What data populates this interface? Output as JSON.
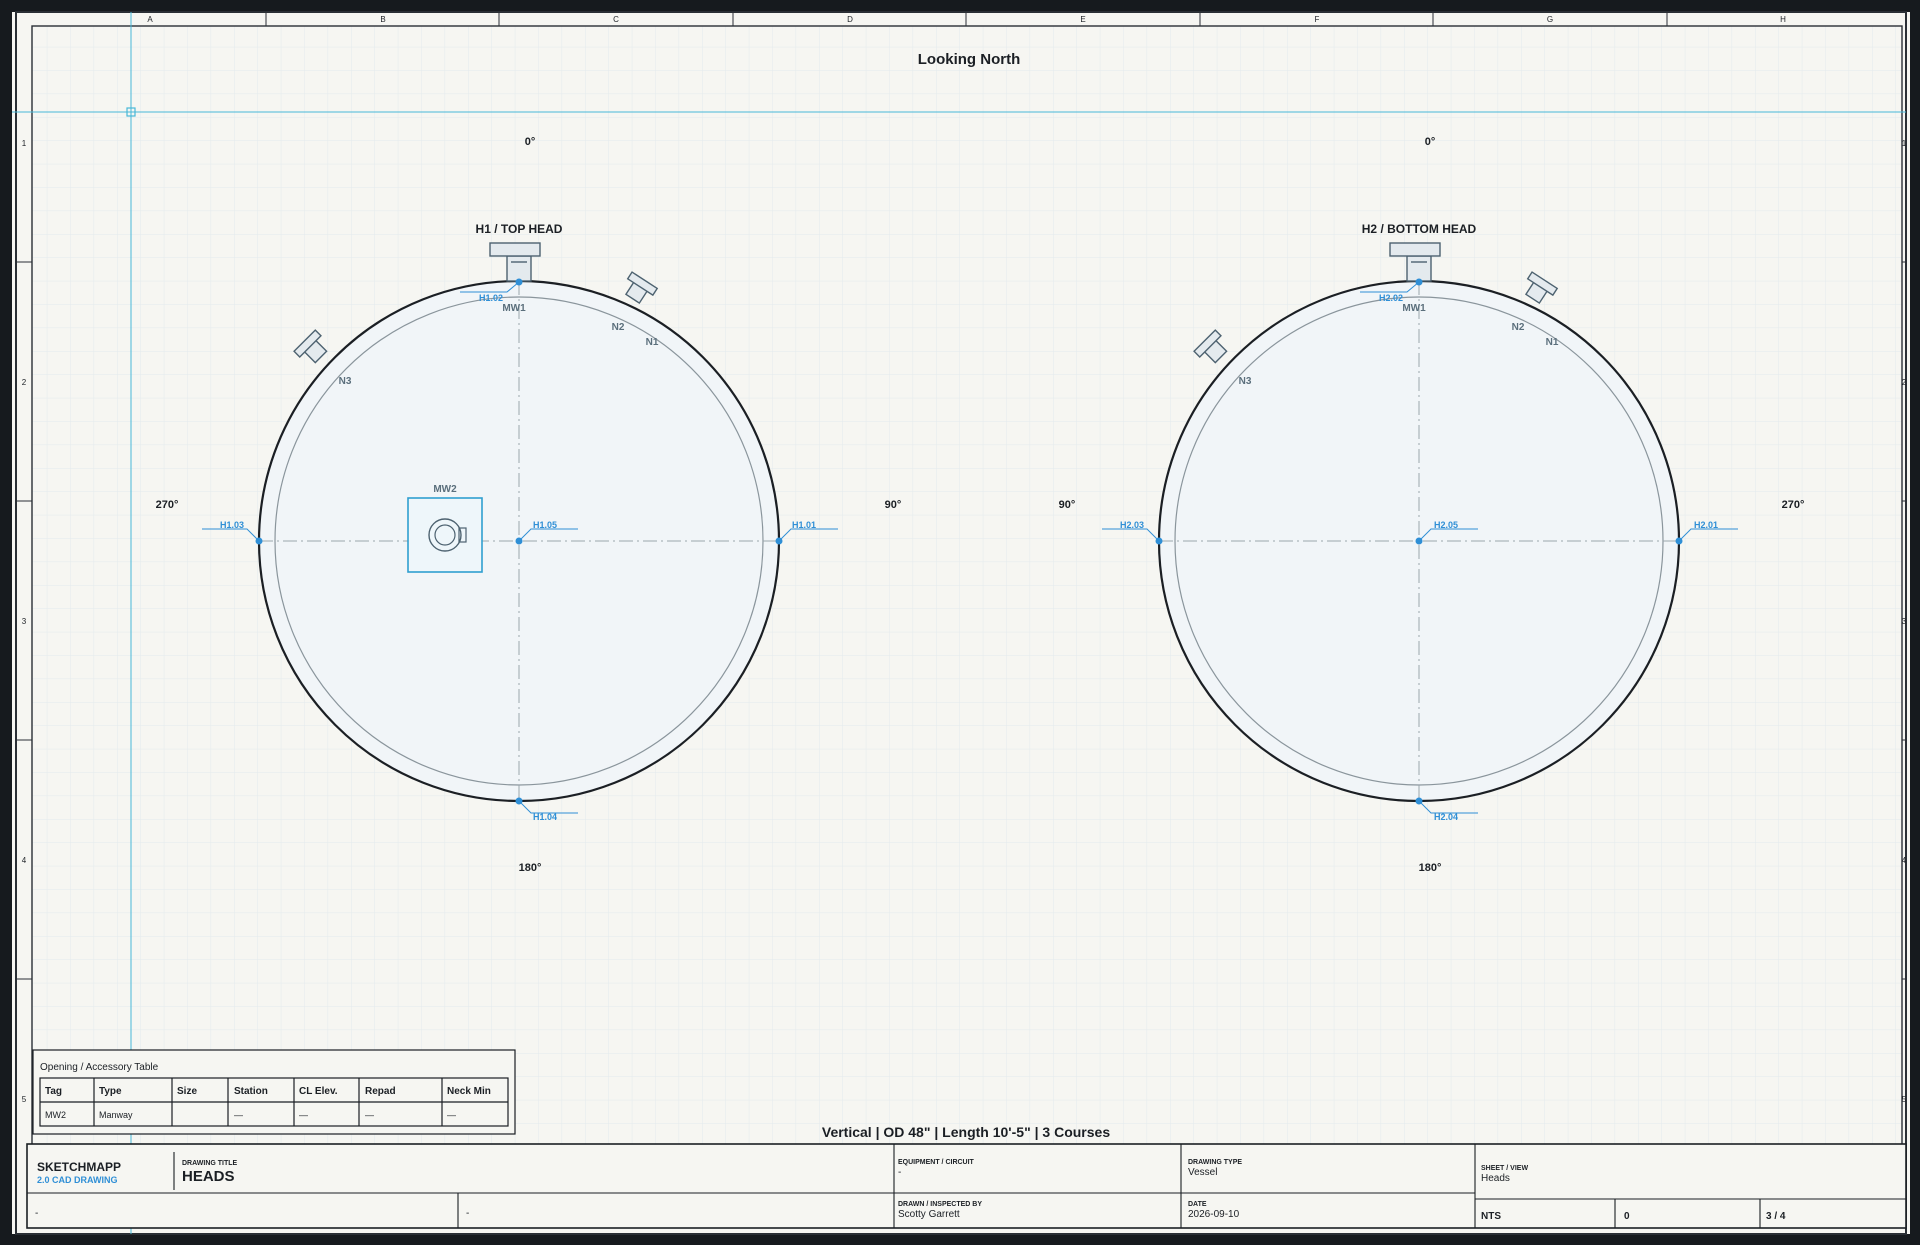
{
  "app": {
    "brand": "SKETCHMAPP",
    "subbrand": "2.0 CAD DRAWING"
  },
  "colors": {
    "accent": "#2f8fd6",
    "paper": "#f6f6f2",
    "ink": "#1b1f24",
    "grid": "#dde5e8",
    "head_fill": "#f1f5f8"
  },
  "frame": {
    "columns": [
      "A",
      "B",
      "C",
      "D",
      "E",
      "F",
      "G",
      "H"
    ],
    "rows": [
      "1",
      "2",
      "3",
      "4",
      "5"
    ]
  },
  "view": {
    "title": "Looking North",
    "footer": "Vertical | OD 48\" | Length 10'-5\" | 3 Courses"
  },
  "heads": [
    {
      "title": "H1 / TOP HEAD",
      "deg_top": "0°",
      "deg_bottom": "180°",
      "deg_left": "270°",
      "deg_right": "90°",
      "points": {
        "top": "H1.02",
        "left": "H1.03",
        "right": "H1.01",
        "bottom": "H1.04",
        "center": "H1.05"
      },
      "nozzles": {
        "top": "MW1",
        "upper_right": "N2",
        "right": "N1",
        "upper_left": "N3"
      },
      "manway_label": "MW2"
    },
    {
      "title": "H2 / BOTTOM HEAD",
      "deg_top": "0°",
      "deg_bottom": "180°",
      "deg_left": "90°",
      "deg_right": "270°",
      "points": {
        "top": "H2.02",
        "left": "H2.03",
        "right": "H2.01",
        "bottom": "H2.04",
        "center": "H2.05"
      },
      "nozzles": {
        "top": "MW1",
        "upper_right": "N2",
        "right": "N1",
        "upper_left": "N3"
      }
    }
  ],
  "table": {
    "title": "Opening / Accessory Table",
    "headers": [
      "Tag",
      "Type",
      "Size",
      "Station",
      "CL Elev.",
      "Repad",
      "Neck Min"
    ],
    "rows": [
      [
        "MW2",
        "Manway",
        "",
        "—",
        "—",
        "—",
        "—"
      ]
    ]
  },
  "title_block": {
    "drawing_title_label": "DRAWING TITLE",
    "drawing_title": "HEADS",
    "equipment_label": "EQUIPMENT / CIRCUIT",
    "equipment": "-",
    "drawing_type_label": "DRAWING TYPE",
    "drawing_type": "Vessel",
    "sheet_label": "SHEET / VIEW",
    "sheet": "Heads",
    "drawn_label": "DRAWN / INSPECTED BY",
    "drawn": "Scotty Garrett",
    "date_label": "DATE",
    "date": "2026-09-10",
    "left_field_1": "-",
    "left_field_2": "-",
    "scale": "NTS",
    "revision": "0",
    "sheet_number": "3 / 4"
  }
}
